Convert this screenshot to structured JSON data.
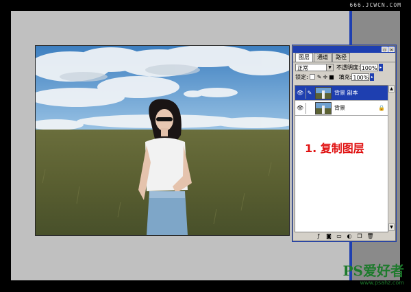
{
  "watermark_top": "666.JCWCN.COM",
  "panel": {
    "tabs": [
      "图层",
      "通道",
      "路径"
    ],
    "active_tab": 0,
    "blend_mode": "正常",
    "opacity_label": "不透明度:",
    "opacity_value": "100%",
    "lock_label": "锁定:",
    "fill_label": "填充:",
    "fill_value": "100%",
    "layers": [
      {
        "name": "背景 副本",
        "selected": true,
        "locked": false
      },
      {
        "name": "背景",
        "selected": false,
        "locked": true
      }
    ],
    "step_label": "1. 复制图层"
  },
  "logo": {
    "main": "PS爱好者",
    "sub": "www.psahz.com"
  },
  "colors": {
    "accent_blue": "#1e3fb0",
    "step_red": "#e01010",
    "logo_green": "#1d7a2c"
  }
}
